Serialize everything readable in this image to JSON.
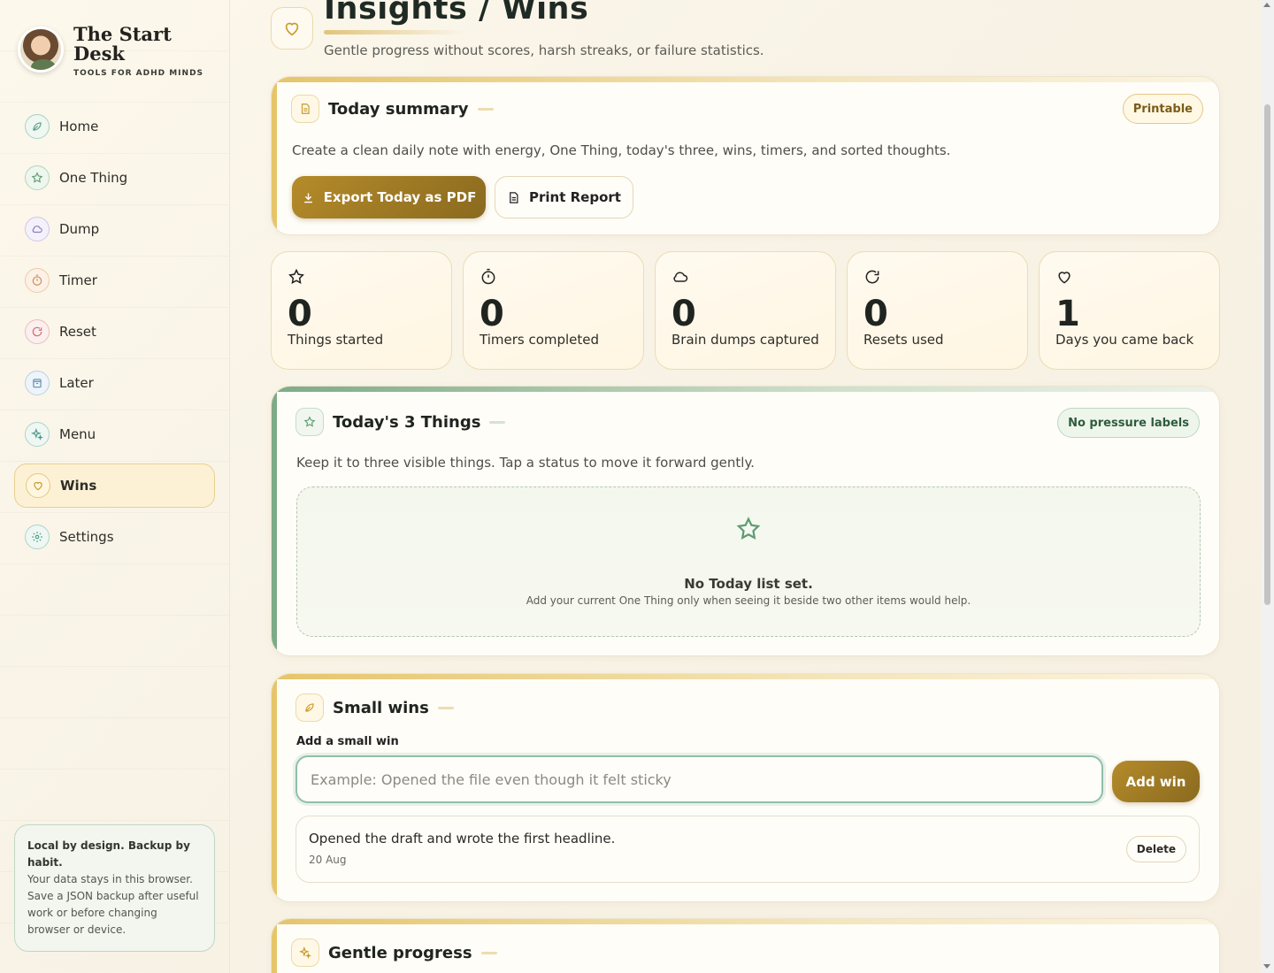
{
  "brand": {
    "title": "The Start Desk",
    "subtitle": "TOOLS FOR ADHD MINDS"
  },
  "sidebar": {
    "items": [
      {
        "label": "Home",
        "icon": "leaf-icon",
        "color": "#5c9e8a"
      },
      {
        "label": "One Thing",
        "icon": "star-icon",
        "color": "#5f9c74"
      },
      {
        "label": "Dump",
        "icon": "cloud-icon",
        "color": "#8e7cc0"
      },
      {
        "label": "Timer",
        "icon": "timer-icon",
        "color": "#d08a53"
      },
      {
        "label": "Reset",
        "icon": "reset-icon",
        "color": "#d46a6a"
      },
      {
        "label": "Later",
        "icon": "box-icon",
        "color": "#5c8fb3"
      },
      {
        "label": "Menu",
        "icon": "sparkle-icon",
        "color": "#4f9a8c"
      },
      {
        "label": "Wins",
        "icon": "heart-icon",
        "color": "#c89a2c"
      },
      {
        "label": "Settings",
        "icon": "gear-icon",
        "color": "#4f9a8c"
      }
    ],
    "note_bold": "Local by design. Backup by habit.",
    "note_text": "Your data stays in this browser. Save a JSON backup after useful work or before changing browser or device."
  },
  "header": {
    "title": "Insights / Wins",
    "subtitle": "Gentle progress without scores, harsh streaks, or failure statistics."
  },
  "summary": {
    "title": "Today summary",
    "badge": "Printable",
    "description": "Create a clean daily note with energy, One Thing, today's three, wins, timers, and sorted thoughts.",
    "export_label": "Export Today as PDF",
    "print_label": "Print Report"
  },
  "stats": [
    {
      "value": "0",
      "label": "Things started",
      "icon": "star-icon"
    },
    {
      "value": "0",
      "label": "Timers completed",
      "icon": "timer-icon"
    },
    {
      "value": "0",
      "label": "Brain dumps captured",
      "icon": "cloud-icon"
    },
    {
      "value": "0",
      "label": "Resets used",
      "icon": "reset-icon"
    },
    {
      "value": "1",
      "label": "Days you came back",
      "icon": "heart-icon"
    }
  ],
  "three_things": {
    "title": "Today's 3 Things",
    "badge": "No pressure labels",
    "description": "Keep it to three visible things. Tap a status to move it forward gently.",
    "empty_title": "No Today list set.",
    "empty_text": "Add your current One Thing only when seeing it beside two other items would help."
  },
  "wins": {
    "title": "Small wins",
    "input_label": "Add a small win",
    "placeholder": "Example: Opened the file even though it felt sticky",
    "add_label": "Add win",
    "items": [
      {
        "text": "Opened the draft and wrote the first headline.",
        "date": "20 Aug",
        "delete_label": "Delete"
      }
    ]
  },
  "progress": {
    "title": "Gentle progress"
  },
  "colors": {
    "accent_gold": "#b58b2a",
    "accent_green": "#7eab86",
    "background": "#fdf8ec"
  }
}
